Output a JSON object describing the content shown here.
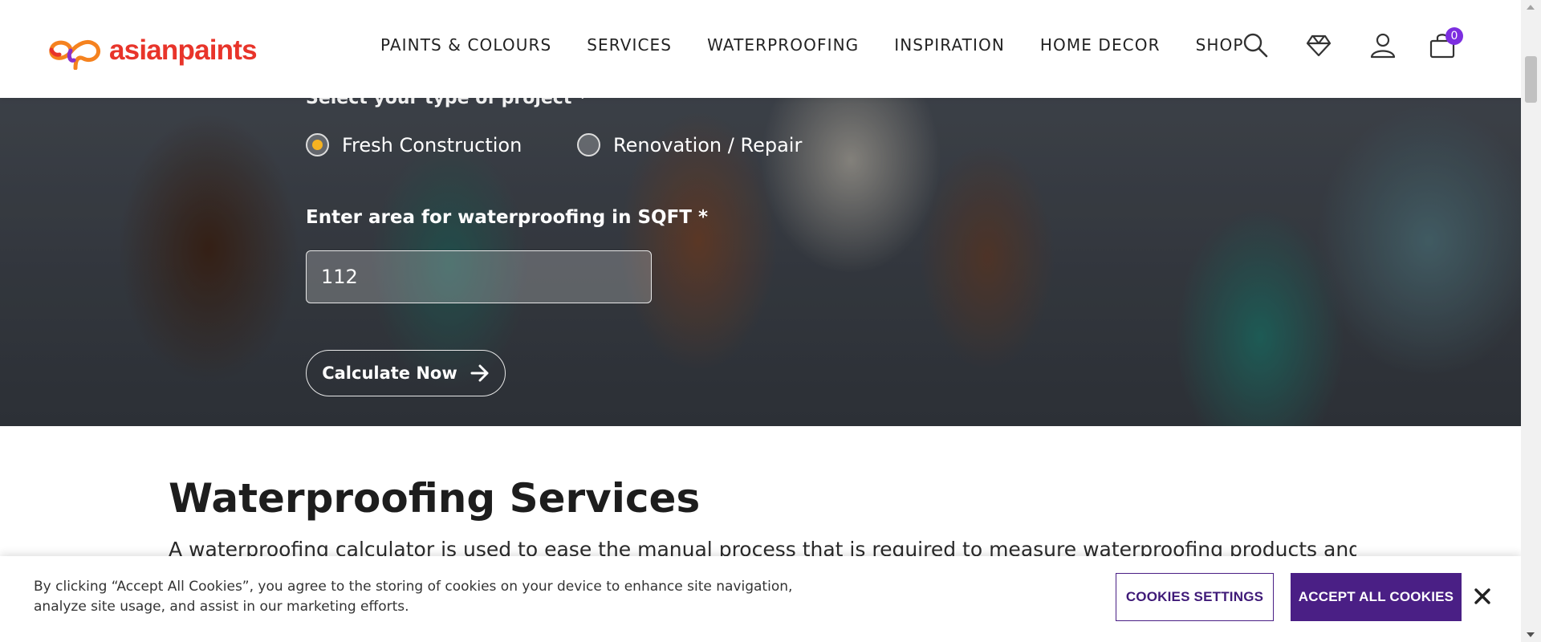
{
  "header": {
    "logo_text": "asianpaints",
    "nav": [
      "PAINTS & COLOURS",
      "SERVICES",
      "WATERPROOFING",
      "INSPIRATION",
      "HOME DECOR",
      "SHOP"
    ],
    "icons": [
      "search-icon",
      "wishlist-heart-icon",
      "user-account-icon",
      "cart-bag-icon"
    ],
    "cart_count": "0",
    "brand_colors": {
      "orange": "#f5821f",
      "red": "#e8342a",
      "purple": "#7c2ee0"
    }
  },
  "calculator": {
    "project_label": "Select your type of project *",
    "project_options": [
      {
        "label": "Fresh Construction",
        "selected": true
      },
      {
        "label": "Renovation / Repair",
        "selected": false
      }
    ],
    "area_label": "Enter area for waterproofing in SQFT *",
    "area_value": "112",
    "calculate_label": "Calculate Now",
    "accent_color": "#f6b321"
  },
  "services": {
    "title": "Waterproofing Services",
    "description": "A waterproofing calculator is used to ease the manual process that is required to measure waterproofing products and the"
  },
  "cookie_banner": {
    "text": "By clicking “Accept All Cookies”, you agree to the storing of cookies on your device to enhance site navigation, analyze site usage, and assist in our marketing efforts.",
    "settings_label": "COOKIES SETTINGS",
    "accept_label": "ACCEPT ALL COOKIES",
    "button_color": "#4a1f85"
  }
}
